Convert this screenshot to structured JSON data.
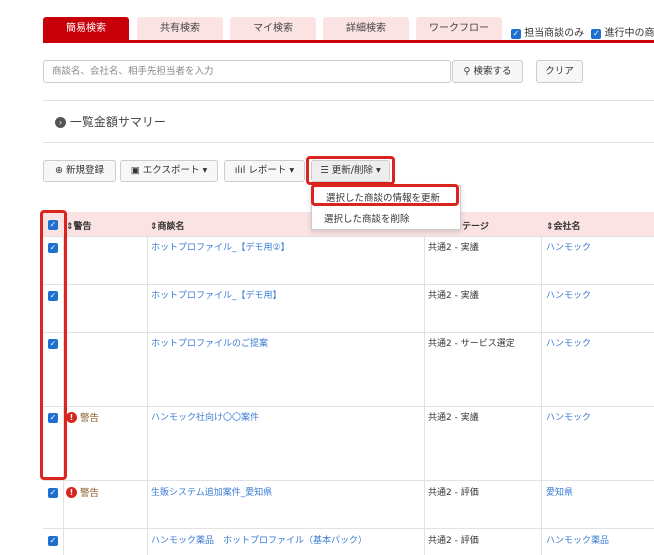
{
  "tabs": [
    {
      "label": "簡易検索",
      "active": true
    },
    {
      "label": "共有検索",
      "active": false
    },
    {
      "label": "マイ検索",
      "active": false
    },
    {
      "label": "詳細検索",
      "active": false
    },
    {
      "label": "ワークフロー",
      "active": false
    }
  ],
  "filters": {
    "own_deals": "担当商談のみ",
    "in_progress": "進行中の商"
  },
  "search": {
    "placeholder": "商談名、会社名、相手先担当者を入力",
    "search_button": "検索する",
    "clear_button": "クリア"
  },
  "summary": {
    "title": "一覧金額サマリー"
  },
  "toolbar": {
    "new_label": "新規登録",
    "export_label": "エクスポート",
    "report_label": "レポート",
    "update_delete_label": "更新/削除"
  },
  "dropdown": {
    "items": [
      "選択した商談の情報を更新",
      "選択した商談を削除"
    ]
  },
  "table": {
    "headers": {
      "warning": "警告",
      "deal_name": "商談名",
      "stage": "テージ",
      "company": "会社名"
    },
    "rows": [
      {
        "checked": true,
        "warning": "",
        "deal_name": "ホットプロファイル_【デモ用②】",
        "stage": "共通2 - 実議",
        "company": "ハンモック"
      },
      {
        "checked": true,
        "warning": "",
        "deal_name": "ホットプロファイル_【デモ用】",
        "stage": "共通2 - 実議",
        "company": "ハンモック"
      },
      {
        "checked": true,
        "warning": "",
        "deal_name": "ホットプロファイルのご提案",
        "stage": "共通2 - サービス選定",
        "company": "ハンモック"
      },
      {
        "checked": true,
        "warning": "警告",
        "deal_name": "ハンモック社向け〇〇案件",
        "stage": "共通2 - 実議",
        "company": "ハンモック"
      },
      {
        "checked": true,
        "warning": "警告",
        "deal_name": "生販システム追加案件_愛知県",
        "stage": "共通2 - 評価",
        "company": "愛知県"
      },
      {
        "checked": true,
        "warning": "",
        "deal_name": "ハンモック薬品　ホットプロファイル（基本パック）",
        "stage": "共通2 - 評価",
        "company": "ハンモック薬品"
      }
    ]
  }
}
